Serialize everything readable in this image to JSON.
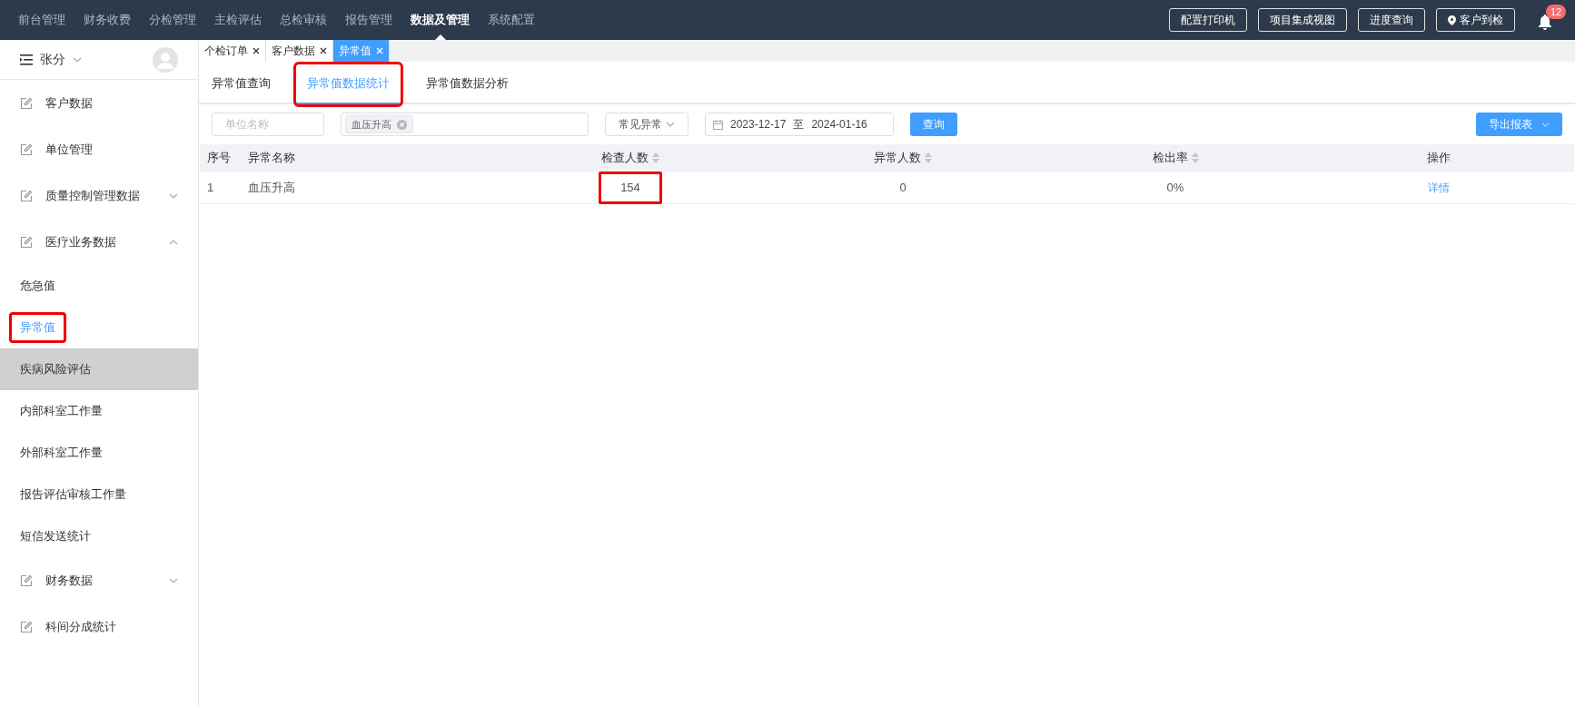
{
  "top_nav": {
    "items": [
      {
        "label": "前台管理",
        "selected": false
      },
      {
        "label": "财务收费",
        "selected": false
      },
      {
        "label": "分检管理",
        "selected": false
      },
      {
        "label": "主检评估",
        "selected": false
      },
      {
        "label": "总检审核",
        "selected": false
      },
      {
        "label": "报告管理",
        "selected": false
      },
      {
        "label": "数据及管理",
        "selected": true
      },
      {
        "label": "系统配置",
        "selected": false
      }
    ],
    "buttons": [
      {
        "label": "配置打印机",
        "kind": "plain"
      },
      {
        "label": "项目集成视图",
        "kind": "plain"
      },
      {
        "label": "进度查询",
        "kind": "plain"
      },
      {
        "label": "客户到检",
        "kind": "pin"
      }
    ],
    "notification_count": "12"
  },
  "sidebar": {
    "user": "张分",
    "items": [
      {
        "label": "客户数据",
        "kind": "link"
      },
      {
        "label": "单位管理",
        "kind": "link"
      },
      {
        "label": "质量控制管理数据",
        "kind": "group",
        "expanded": false
      },
      {
        "label": "医疗业务数据",
        "kind": "group",
        "expanded": true
      },
      {
        "label": "危急值",
        "kind": "sub",
        "selected": false,
        "hovered": false,
        "highlighted": false
      },
      {
        "label": "异常值",
        "kind": "sub",
        "selected": true,
        "hovered": false,
        "highlighted": true
      },
      {
        "label": "疾病风险评估",
        "kind": "sub",
        "selected": false,
        "hovered": true,
        "highlighted": false
      },
      {
        "label": "内部科室工作量",
        "kind": "sub",
        "selected": false,
        "hovered": false,
        "highlighted": false
      },
      {
        "label": "外部科室工作量",
        "kind": "sub",
        "selected": false,
        "hovered": false,
        "highlighted": false
      },
      {
        "label": "报告评估审核工作量",
        "kind": "sub",
        "selected": false,
        "hovered": false,
        "highlighted": false
      },
      {
        "label": "短信发送统计",
        "kind": "sub",
        "selected": false,
        "hovered": false,
        "highlighted": false
      },
      {
        "label": "财务数据",
        "kind": "group",
        "expanded": false
      },
      {
        "label": "科间分成统计",
        "kind": "link"
      }
    ]
  },
  "page_tabs": [
    {
      "label": "个检订单",
      "selected": false
    },
    {
      "label": "客户数据",
      "selected": false
    },
    {
      "label": "异常值",
      "selected": true
    }
  ],
  "sub_tabs": [
    {
      "label": "异常值查询",
      "selected": false,
      "highlighted": false
    },
    {
      "label": "异常值数据统计",
      "selected": true,
      "highlighted": true
    },
    {
      "label": "异常值数据分析",
      "selected": false,
      "highlighted": false
    }
  ],
  "filters": {
    "unit_placeholder": "单位名称",
    "tag": "血压升高",
    "type_select": "常见异常",
    "date_from": "2023-12-17",
    "date_sep": "至",
    "date_to": "2024-01-16",
    "query_button": "查询",
    "export_button": "导出报表"
  },
  "table": {
    "columns": [
      {
        "label": "序号",
        "sortable": false
      },
      {
        "label": "异常名称",
        "sortable": false
      },
      {
        "label": "检查人数",
        "sortable": true
      },
      {
        "label": "异常人数",
        "sortable": true
      },
      {
        "label": "检出率",
        "sortable": true
      },
      {
        "label": "操作",
        "sortable": false
      }
    ],
    "rows": [
      {
        "index": "1",
        "name": "血压升高",
        "checked_count": "154",
        "checked_count_highlighted": true,
        "abnormal_count": "0",
        "rate": "0%",
        "action": "详情"
      }
    ]
  }
}
